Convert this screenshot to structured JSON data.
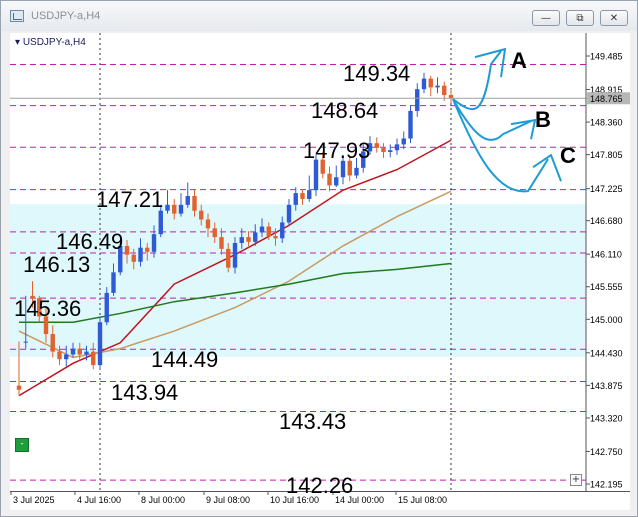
{
  "window": {
    "title": "USDJPY-a,H4",
    "buttons": {
      "minimize": "—",
      "restore": "⧉",
      "close": "✕"
    }
  },
  "chart": {
    "symbol_label": "USDJPY-a,H4",
    "green_marker": "-",
    "plus_marker": "+",
    "price_ticks": [
      "149.485",
      "148.915",
      "148.765",
      "148.360",
      "147.805",
      "147.225",
      "146.680",
      "146.110",
      "145.555",
      "145.000",
      "144.430",
      "143.875",
      "143.320",
      "142.750",
      "142.195"
    ],
    "current_price_label": "148.765",
    "time_ticks": [
      "3 Jul 2025",
      "4 Jul 16:00",
      "8 Jul 00:00",
      "9 Jul 08:00",
      "10 Jul 16:00",
      "14 Jul 00:00",
      "15 Jul 08:00"
    ],
    "level_annotations": [
      "149.34",
      "148.64",
      "147.93",
      "147.21",
      "146.49",
      "146.13",
      "145.36",
      "144.49",
      "143.94",
      "143.43",
      "142.26"
    ],
    "scenario_labels": [
      "A",
      "B",
      "C"
    ],
    "colors": {
      "bull_candle": "#2f5ad6",
      "bear_candle": "#e0622e",
      "ma_red": "#c0141e",
      "ma_tan": "#c99a62",
      "ma_green": "#1f7a1f",
      "level_lines": "#c21fb0",
      "zone": "#dff8fb",
      "arrows": "#1e9bd7"
    }
  },
  "chart_data": {
    "type": "candlestick",
    "symbol": "USDJPY-a",
    "timeframe": "H4",
    "ylim": [
      142.195,
      149.49
    ],
    "candles": [
      [
        143.87,
        143.8,
        144.62,
        143.7
      ],
      [
        144.62,
        144.62,
        145.4,
        144.5
      ],
      [
        145.4,
        145.36,
        145.65,
        145.2
      ],
      [
        145.36,
        145.05,
        145.4,
        144.95
      ],
      [
        145.05,
        144.75,
        145.2,
        144.6
      ],
      [
        144.75,
        144.45,
        144.9,
        144.35
      ],
      [
        144.45,
        144.32,
        144.55,
        144.22
      ],
      [
        144.32,
        144.4,
        144.55,
        144.2
      ],
      [
        144.4,
        144.5,
        144.6,
        144.35
      ],
      [
        144.5,
        144.4,
        144.6,
        144.3
      ],
      [
        144.4,
        144.45,
        144.55,
        144.3
      ],
      [
        144.45,
        144.22,
        144.6,
        144.15
      ],
      [
        144.22,
        144.95,
        145.05,
        144.15
      ],
      [
        144.95,
        145.45,
        145.55,
        144.9
      ],
      [
        145.45,
        145.8,
        145.95,
        145.4
      ],
      [
        145.8,
        146.25,
        146.35,
        145.75
      ],
      [
        146.25,
        146.1,
        146.35,
        145.95
      ],
      [
        146.1,
        145.98,
        146.2,
        145.85
      ],
      [
        145.98,
        146.22,
        146.38,
        145.9
      ],
      [
        146.22,
        146.15,
        146.3,
        146.0
      ],
      [
        146.15,
        146.45,
        146.6,
        146.05
      ],
      [
        146.45,
        146.85,
        146.95,
        146.4
      ],
      [
        146.85,
        146.95,
        147.2,
        146.8
      ],
      [
        146.95,
        146.8,
        147.05,
        146.7
      ],
      [
        146.8,
        146.95,
        147.15,
        146.75
      ],
      [
        146.95,
        147.1,
        147.33,
        146.9
      ],
      [
        147.1,
        146.85,
        147.2,
        146.75
      ],
      [
        146.85,
        146.7,
        146.95,
        146.6
      ],
      [
        146.7,
        146.55,
        146.8,
        146.4
      ],
      [
        146.55,
        146.4,
        146.65,
        146.3
      ],
      [
        146.4,
        146.2,
        146.55,
        146.1
      ],
      [
        146.2,
        145.88,
        146.3,
        145.8
      ],
      [
        145.88,
        146.3,
        146.4,
        145.78
      ],
      [
        146.3,
        146.4,
        146.55,
        146.2
      ],
      [
        146.4,
        146.32,
        146.5,
        146.25
      ],
      [
        146.32,
        146.48,
        146.62,
        146.25
      ],
      [
        146.48,
        146.58,
        146.72,
        146.4
      ],
      [
        146.58,
        146.42,
        146.65,
        146.35
      ],
      [
        146.42,
        146.38,
        146.55,
        146.25
      ],
      [
        146.38,
        146.65,
        146.75,
        146.3
      ],
      [
        146.65,
        146.95,
        147.05,
        146.6
      ],
      [
        146.95,
        147.15,
        147.25,
        146.85
      ],
      [
        147.15,
        147.05,
        147.22,
        146.95
      ],
      [
        147.05,
        147.2,
        147.45,
        147.0
      ],
      [
        147.2,
        147.72,
        147.8,
        147.1
      ],
      [
        147.72,
        147.48,
        147.85,
        147.4
      ],
      [
        147.48,
        147.28,
        147.6,
        147.18
      ],
      [
        147.28,
        147.42,
        147.62,
        147.25
      ],
      [
        147.42,
        147.7,
        147.8,
        147.3
      ],
      [
        147.7,
        147.45,
        147.78,
        147.35
      ],
      [
        147.45,
        147.58,
        147.75,
        147.4
      ],
      [
        147.58,
        147.86,
        147.98,
        147.5
      ],
      [
        147.86,
        148.0,
        148.12,
        147.8
      ],
      [
        148.0,
        147.92,
        148.1,
        147.84
      ],
      [
        147.92,
        147.85,
        148.0,
        147.75
      ],
      [
        147.85,
        147.88,
        147.98,
        147.76
      ],
      [
        147.88,
        147.98,
        148.08,
        147.8
      ],
      [
        147.98,
        148.08,
        148.2,
        147.9
      ],
      [
        148.08,
        148.55,
        148.65,
        148.0
      ],
      [
        148.55,
        148.92,
        149.02,
        148.45
      ],
      [
        148.92,
        149.1,
        149.2,
        148.85
      ],
      [
        149.1,
        148.95,
        149.15,
        148.8
      ],
      [
        148.95,
        148.98,
        149.12,
        148.85
      ],
      [
        148.98,
        148.82,
        149.05,
        148.72
      ],
      [
        148.82,
        148.76,
        148.92,
        148.68
      ]
    ],
    "moving_averages": [
      {
        "color": "red",
        "points": [
          [
            0,
            143.7
          ],
          [
            8,
            144.25
          ],
          [
            15,
            144.6
          ],
          [
            23,
            145.6
          ],
          [
            32,
            146.1
          ],
          [
            40,
            146.6
          ],
          [
            48,
            147.2
          ],
          [
            56,
            147.55
          ],
          [
            64,
            148.05
          ]
        ]
      },
      {
        "color": "tan",
        "points": [
          [
            0,
            144.8
          ],
          [
            8,
            144.35
          ],
          [
            15,
            144.5
          ],
          [
            23,
            144.8
          ],
          [
            32,
            145.2
          ],
          [
            40,
            145.65
          ],
          [
            48,
            146.25
          ],
          [
            56,
            146.75
          ],
          [
            64,
            147.18
          ]
        ]
      },
      {
        "color": "green",
        "points": [
          [
            0,
            144.95
          ],
          [
            8,
            144.95
          ],
          [
            15,
            145.1
          ],
          [
            23,
            145.3
          ],
          [
            32,
            145.45
          ],
          [
            40,
            145.6
          ],
          [
            48,
            145.78
          ],
          [
            56,
            145.85
          ],
          [
            64,
            145.95
          ]
        ]
      }
    ]
  }
}
